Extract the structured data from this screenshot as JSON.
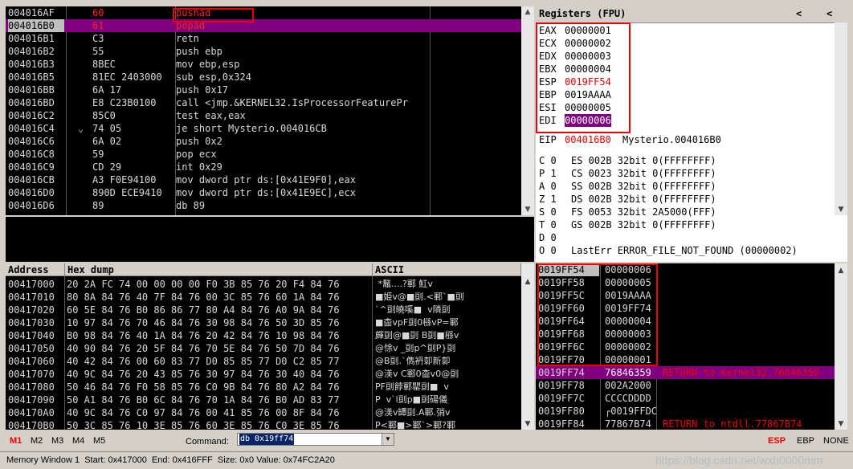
{
  "disasm": {
    "rows": [
      {
        "addr": "004016AF",
        "hex": "60",
        "asm": "pushad"
      },
      {
        "addr": "004016B0",
        "hex": "61",
        "asm": "popad"
      },
      {
        "addr": "004016B1",
        "hex": "C3",
        "asm": "retn"
      },
      {
        "addr": "004016B2",
        "hex": "55",
        "asm": "push ebp"
      },
      {
        "addr": "004016B3",
        "hex": "8BEC",
        "asm": "mov ebp,esp"
      },
      {
        "addr": "004016B5",
        "hex": "81EC 2403000",
        "asm": "sub esp,0x324"
      },
      {
        "addr": "004016BB",
        "hex": "6A 17",
        "asm": "push 0x17"
      },
      {
        "addr": "004016BD",
        "hex": "E8 C23B0100",
        "asm": "call <jmp.&KERNEL32.IsProcessorFeaturePr"
      },
      {
        "addr": "004016C2",
        "hex": "85C0",
        "asm": "test eax,eax"
      },
      {
        "addr": "004016C4",
        "hex": "74 05",
        "asm": "je short Mysterio.004016CB",
        "jmp": "⌄"
      },
      {
        "addr": "004016C6",
        "hex": "6A 02",
        "asm": "push 0x2"
      },
      {
        "addr": "004016C8",
        "hex": "59",
        "asm": "pop ecx"
      },
      {
        "addr": "004016C9",
        "hex": "CD 29",
        "asm": "int 0x29"
      },
      {
        "addr": "004016CB",
        "hex": "A3 F0E94100",
        "asm": "mov dword ptr ds:[0x41E9F0],eax"
      },
      {
        "addr": "004016D0",
        "hex": "890D ECE9410",
        "asm": "mov dword ptr ds:[0x41E9EC],ecx"
      },
      {
        "addr": "004016D6",
        "hex": "89",
        "asm": "db 89"
      }
    ]
  },
  "registers": {
    "title": "Registers (FPU)",
    "nav_left": "<",
    "nav_right": "<",
    "gp": [
      {
        "name": "EAX",
        "value": "00000001"
      },
      {
        "name": "ECX",
        "value": "00000002"
      },
      {
        "name": "EDX",
        "value": "00000003"
      },
      {
        "name": "EBX",
        "value": "00000004"
      },
      {
        "name": "ESP",
        "value": "0019FF54"
      },
      {
        "name": "EBP",
        "value": "0019AAAA"
      },
      {
        "name": "ESI",
        "value": "00000005"
      },
      {
        "name": "EDI",
        "value": "00000006"
      }
    ],
    "eip": {
      "name": "EIP",
      "value": "004016B0",
      "comment": "Mysterio.004016B0"
    },
    "seg": [
      {
        "flag": "C 0",
        "text": "ES 002B 32bit 0(FFFFFFFF)"
      },
      {
        "flag": "P 1",
        "text": "CS 0023 32bit 0(FFFFFFFF)"
      },
      {
        "flag": "A 0",
        "text": "SS 002B 32bit 0(FFFFFFFF)"
      },
      {
        "flag": "Z 1",
        "text": "DS 002B 32bit 0(FFFFFFFF)"
      },
      {
        "flag": "S 0",
        "text": "FS 0053 32bit 2A5000(FFF)"
      },
      {
        "flag": "T 0",
        "text": "GS 002B 32bit 0(FFFFFFFF)"
      },
      {
        "flag": "D 0",
        "text": ""
      },
      {
        "flag": "O 0",
        "text": "LastErr ERROR_FILE_NOT_FOUND (00000002)"
      }
    ]
  },
  "dump": {
    "hdr_address": "Address",
    "hdr_hex": "Hex dump",
    "hdr_ascii": "ASCII",
    "rows": [
      {
        "addr": "00417000",
        "hex": "20 2A FC 74 00 00 00 00 F0 3B 85 76 20 F4 84 76",
        "ascii": " *鼇....?鄆 魟v"
      },
      {
        "addr": "00417010",
        "hex": "80 8A 84 76 40 7F 84 76 00 3C 85 76 60 1A 84 76",
        "ascii": "■姫v@■刯.<鄆`■刯"
      },
      {
        "addr": "00417020",
        "hex": "60 5E 84 76 B0 86 86 77 80 A4 84 76 A0 9A 84 76",
        "ascii": "`^刯皢嗘■  v隣刯"
      },
      {
        "addr": "00417030",
        "hex": "10 97 84 76 70 46 84 76 30 98 84 76 50 3D 85 76",
        "ascii": "■楍vpF刯0槂vP=鄆"
      },
      {
        "addr": "00417040",
        "hB": "",
        "hex": "B0 98 84 76 40 1A 84 76 20 42 84 76 10 98 84 76",
        "ascii": "皹刯@■刯 B刯■槂v"
      },
      {
        "addr": "00417050",
        "hex": "40 90 84 76 20 5F 84 76 70 5E 84 76 50 7D 84 76",
        "ascii": "@悇v _刯p^刯P}刯"
      },
      {
        "addr": "00417060",
        "hex": "40 42 84 76 00 60 83 77 D0 85 85 77 D0 C2 85 77",
        "ascii": "@B刯.`儁袇厀新厀"
      },
      {
        "addr": "00417070",
        "hex": "40 9C 84 76 20 43 85 76 30 97 84 76 30 40 84 76",
        "ascii": "@渼v C鄆0楍v0@刯"
      },
      {
        "addr": "00417080",
        "hex": "50 46 84 76 F0 58 85 76 C0 9B 84 76 80 A2 84 76",
        "ascii": "PF刯餑鄆罌刯■  v"
      },
      {
        "addr": "00417090",
        "hex": "50 A1 84 76 B0 6C 84 76 70 1A 84 76 B0 AD 83 77",
        "ascii": "P  v`l刯p■刯碭儀"
      },
      {
        "addr": "004170A0",
        "hex": "40 9C 84 76 C0 97 84 76 00 41 85 76 00 8F 84 76",
        "ascii": "@渼v罈刯.A鄆.弰v"
      },
      {
        "addr": "004170B0",
        "hex": "50 3C 85 76 10 3E 85 76 60 3E 85 76 C0 3E 85 76",
        "ascii": "P<鄆■>鄆`>鄆?鄆"
      }
    ]
  },
  "stack": {
    "rows": [
      {
        "addr": "0019FF54",
        "value": "00000006",
        "comment": ""
      },
      {
        "addr": "0019FF58",
        "value": "00000005",
        "comment": ""
      },
      {
        "addr": "0019FF5C",
        "value": "0019AAAA",
        "comment": ""
      },
      {
        "addr": "0019FF60",
        "value": "0019FF74",
        "comment": ""
      },
      {
        "addr": "0019FF64",
        "value": "00000004",
        "comment": ""
      },
      {
        "addr": "0019FF68",
        "value": "00000003",
        "comment": ""
      },
      {
        "addr": "0019FF6C",
        "value": "00000002",
        "comment": ""
      },
      {
        "addr": "0019FF70",
        "value": "00000001",
        "comment": ""
      },
      {
        "addr": "0019FF74",
        "value": "76846359",
        "comment": "RETURN to kernel32.76846359"
      },
      {
        "addr": "0019FF78",
        "value": "002A2000",
        "comment": ""
      },
      {
        "addr": "0019FF7C",
        "value": "CCCCDDDD",
        "comment": ""
      },
      {
        "addr": "0019FF80",
        "value": "┌0019FFDC",
        "comment": ""
      },
      {
        "addr": "0019FF84",
        "value": "77867B74",
        "comment": "RETURN to ntdll.77867B74"
      }
    ]
  },
  "commandbar": {
    "memtabs": [
      "M1",
      "M2",
      "M3",
      "M4",
      "M5"
    ],
    "command_label": "Command:",
    "command_value": "db 0x19ff74",
    "reg_esp": "ESP",
    "reg_ebp": "EBP",
    "reg_none": "NONE"
  },
  "status": {
    "text": "Memory Window 1  Start: 0x417000  End: 0x416FFF  Size: 0x0 Value: 0x74FC2A20",
    "watermark": "https://blog.csdn.net/wxh0000mm"
  }
}
